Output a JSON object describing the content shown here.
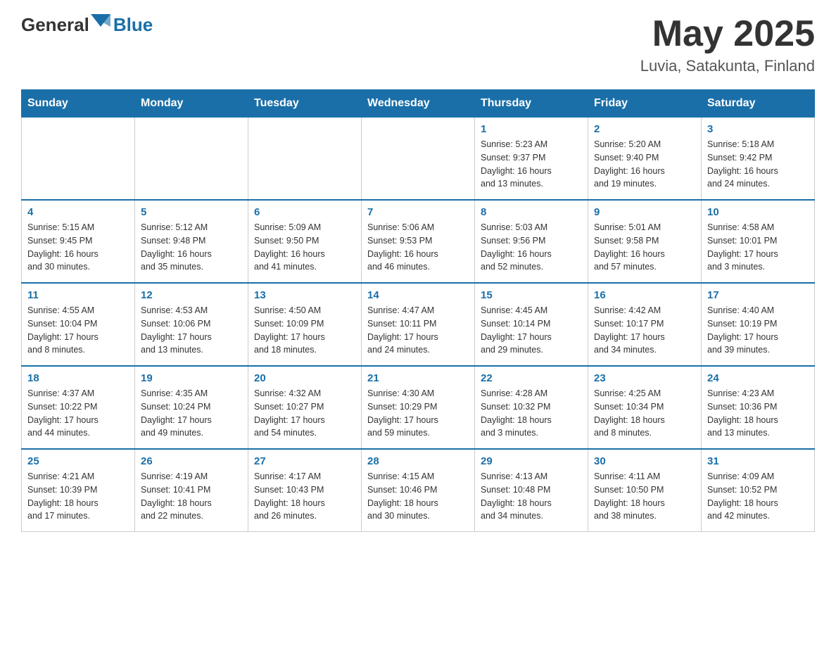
{
  "header": {
    "logo_general": "General",
    "logo_blue": "Blue",
    "month_title": "May 2025",
    "location": "Luvia, Satakunta, Finland"
  },
  "days_of_week": [
    "Sunday",
    "Monday",
    "Tuesday",
    "Wednesday",
    "Thursday",
    "Friday",
    "Saturday"
  ],
  "weeks": [
    [
      {
        "day": "",
        "info": ""
      },
      {
        "day": "",
        "info": ""
      },
      {
        "day": "",
        "info": ""
      },
      {
        "day": "",
        "info": ""
      },
      {
        "day": "1",
        "info": "Sunrise: 5:23 AM\nSunset: 9:37 PM\nDaylight: 16 hours\nand 13 minutes."
      },
      {
        "day": "2",
        "info": "Sunrise: 5:20 AM\nSunset: 9:40 PM\nDaylight: 16 hours\nand 19 minutes."
      },
      {
        "day": "3",
        "info": "Sunrise: 5:18 AM\nSunset: 9:42 PM\nDaylight: 16 hours\nand 24 minutes."
      }
    ],
    [
      {
        "day": "4",
        "info": "Sunrise: 5:15 AM\nSunset: 9:45 PM\nDaylight: 16 hours\nand 30 minutes."
      },
      {
        "day": "5",
        "info": "Sunrise: 5:12 AM\nSunset: 9:48 PM\nDaylight: 16 hours\nand 35 minutes."
      },
      {
        "day": "6",
        "info": "Sunrise: 5:09 AM\nSunset: 9:50 PM\nDaylight: 16 hours\nand 41 minutes."
      },
      {
        "day": "7",
        "info": "Sunrise: 5:06 AM\nSunset: 9:53 PM\nDaylight: 16 hours\nand 46 minutes."
      },
      {
        "day": "8",
        "info": "Sunrise: 5:03 AM\nSunset: 9:56 PM\nDaylight: 16 hours\nand 52 minutes."
      },
      {
        "day": "9",
        "info": "Sunrise: 5:01 AM\nSunset: 9:58 PM\nDaylight: 16 hours\nand 57 minutes."
      },
      {
        "day": "10",
        "info": "Sunrise: 4:58 AM\nSunset: 10:01 PM\nDaylight: 17 hours\nand 3 minutes."
      }
    ],
    [
      {
        "day": "11",
        "info": "Sunrise: 4:55 AM\nSunset: 10:04 PM\nDaylight: 17 hours\nand 8 minutes."
      },
      {
        "day": "12",
        "info": "Sunrise: 4:53 AM\nSunset: 10:06 PM\nDaylight: 17 hours\nand 13 minutes."
      },
      {
        "day": "13",
        "info": "Sunrise: 4:50 AM\nSunset: 10:09 PM\nDaylight: 17 hours\nand 18 minutes."
      },
      {
        "day": "14",
        "info": "Sunrise: 4:47 AM\nSunset: 10:11 PM\nDaylight: 17 hours\nand 24 minutes."
      },
      {
        "day": "15",
        "info": "Sunrise: 4:45 AM\nSunset: 10:14 PM\nDaylight: 17 hours\nand 29 minutes."
      },
      {
        "day": "16",
        "info": "Sunrise: 4:42 AM\nSunset: 10:17 PM\nDaylight: 17 hours\nand 34 minutes."
      },
      {
        "day": "17",
        "info": "Sunrise: 4:40 AM\nSunset: 10:19 PM\nDaylight: 17 hours\nand 39 minutes."
      }
    ],
    [
      {
        "day": "18",
        "info": "Sunrise: 4:37 AM\nSunset: 10:22 PM\nDaylight: 17 hours\nand 44 minutes."
      },
      {
        "day": "19",
        "info": "Sunrise: 4:35 AM\nSunset: 10:24 PM\nDaylight: 17 hours\nand 49 minutes."
      },
      {
        "day": "20",
        "info": "Sunrise: 4:32 AM\nSunset: 10:27 PM\nDaylight: 17 hours\nand 54 minutes."
      },
      {
        "day": "21",
        "info": "Sunrise: 4:30 AM\nSunset: 10:29 PM\nDaylight: 17 hours\nand 59 minutes."
      },
      {
        "day": "22",
        "info": "Sunrise: 4:28 AM\nSunset: 10:32 PM\nDaylight: 18 hours\nand 3 minutes."
      },
      {
        "day": "23",
        "info": "Sunrise: 4:25 AM\nSunset: 10:34 PM\nDaylight: 18 hours\nand 8 minutes."
      },
      {
        "day": "24",
        "info": "Sunrise: 4:23 AM\nSunset: 10:36 PM\nDaylight: 18 hours\nand 13 minutes."
      }
    ],
    [
      {
        "day": "25",
        "info": "Sunrise: 4:21 AM\nSunset: 10:39 PM\nDaylight: 18 hours\nand 17 minutes."
      },
      {
        "day": "26",
        "info": "Sunrise: 4:19 AM\nSunset: 10:41 PM\nDaylight: 18 hours\nand 22 minutes."
      },
      {
        "day": "27",
        "info": "Sunrise: 4:17 AM\nSunset: 10:43 PM\nDaylight: 18 hours\nand 26 minutes."
      },
      {
        "day": "28",
        "info": "Sunrise: 4:15 AM\nSunset: 10:46 PM\nDaylight: 18 hours\nand 30 minutes."
      },
      {
        "day": "29",
        "info": "Sunrise: 4:13 AM\nSunset: 10:48 PM\nDaylight: 18 hours\nand 34 minutes."
      },
      {
        "day": "30",
        "info": "Sunrise: 4:11 AM\nSunset: 10:50 PM\nDaylight: 18 hours\nand 38 minutes."
      },
      {
        "day": "31",
        "info": "Sunrise: 4:09 AM\nSunset: 10:52 PM\nDaylight: 18 hours\nand 42 minutes."
      }
    ]
  ]
}
